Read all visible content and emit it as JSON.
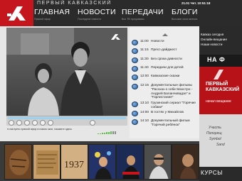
{
  "header": {
    "channel_name": "ПЕРВЫЙ КАВКАЗСКИЙ",
    "datetime": "21.01 Чет. 10:51:18",
    "nav": [
      {
        "title": "ГЛАВНАЯ",
        "subtitle": "Прямой эфир"
      },
      {
        "title": "НОВОСТИ",
        "subtitle": "Последние новости"
      },
      {
        "title": "ПЕРЕДАЧИ",
        "subtitle": "Все ТВ программы"
      },
      {
        "title": "БЛОГИ",
        "subtitle": "Высокие окна мнения"
      }
    ]
  },
  "player": {
    "note": "● смотреть прямой эфир в новом окне, нажмите здесь"
  },
  "schedule": [
    {
      "time": "11:00",
      "title": "Новости"
    },
    {
      "time": "11:15",
      "title": "Пресс-дайджест"
    },
    {
      "time": "11:30",
      "title": "Без срока давности"
    },
    {
      "time": "11:40",
      "title": "Передачи для детей"
    },
    {
      "time": "12:00",
      "title": "Кавказские сказки"
    },
    {
      "time": "12:15",
      "title": "Документальные фильмы \"Рассказ о себе Маэстро - Андрей Баланчивадзе\" и \"Горлистания\""
    },
    {
      "time": "13:10",
      "title": "Грузинский сериал \"Горячие собаки\""
    },
    {
      "time": "14:00",
      "title": "В гостях у Михайлов"
    },
    {
      "time": "14:10",
      "title": "Документальный фильм \"Горячий ребёнок\""
    }
  ],
  "right_column": {
    "link1": "Кавказ сегодня",
    "link2": "Онлайн-вещание",
    "link3": "Наши новости",
    "banner_dark": "НА Ф",
    "banner_red_big": "ПЕРВЫЙ КАВКАЗСКИЙ",
    "banner_red_small": "начал вещание",
    "grey_line1": "Участь",
    "grey_line2": "Попорящ",
    "grey_line3": "Symbol",
    "grey_line4": "Sand",
    "kursy": "КУРСЫ"
  },
  "thumbnails": [
    {
      "label": ""
    },
    {
      "label": ""
    },
    {
      "label": "1937"
    },
    {
      "label": ""
    },
    {
      "label": ""
    },
    {
      "label": ""
    },
    {
      "label": ""
    }
  ],
  "colors": {
    "header_bg": "#2b2b2b",
    "brand_red": "#c4161c",
    "progress": "#9bd1f0",
    "volume": "#5fbf4b"
  }
}
